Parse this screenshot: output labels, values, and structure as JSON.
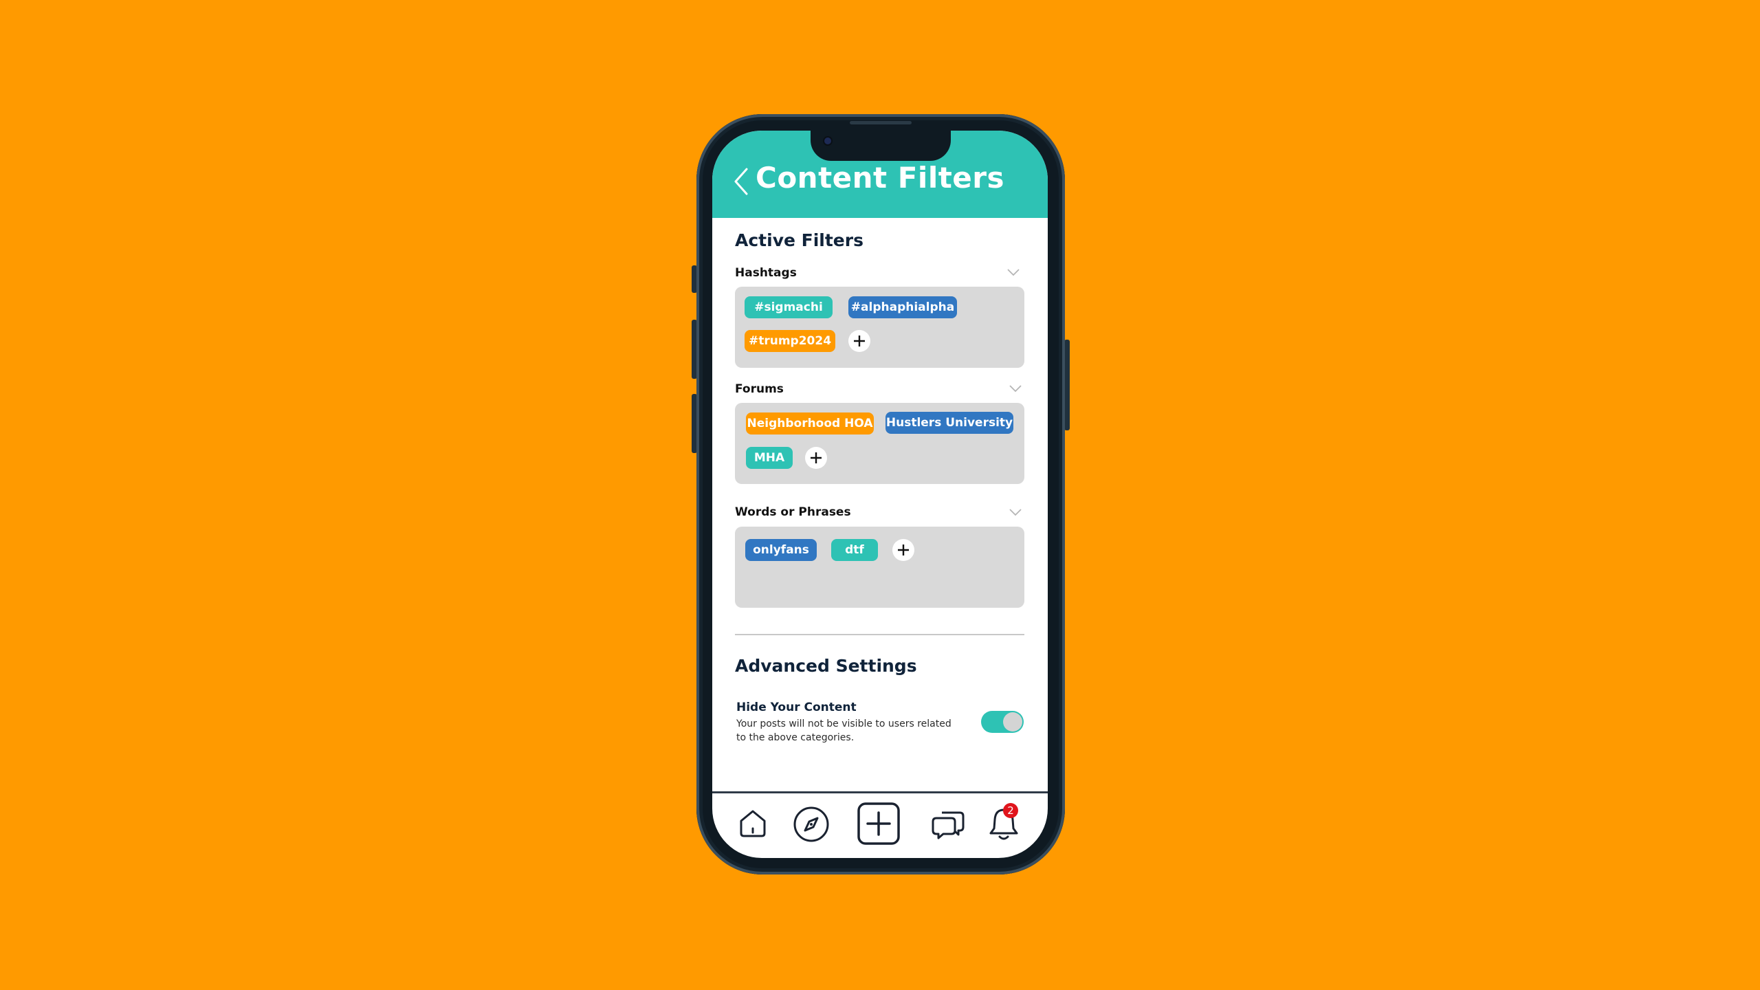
{
  "header": {
    "title": "Content Filters"
  },
  "active_filters": {
    "title": "Active Filters",
    "groups": [
      {
        "label": "Hashtags",
        "chips": [
          "#sigmachi",
          "#alphaphialpha",
          "#trump2024"
        ]
      },
      {
        "label": "Forums",
        "chips": [
          "Neighborhood HOA",
          "Hustlers University",
          "MHA"
        ]
      },
      {
        "label": "Words or Phrases",
        "chips": [
          "onlyfans",
          "dtf"
        ]
      }
    ]
  },
  "advanced": {
    "title": "Advanced Settings",
    "hide_content": {
      "label": "Hide Your Content",
      "description": "Your posts will not be visible to users related to the above categories.",
      "enabled": true
    }
  },
  "tabbar": {
    "notification_count": "2",
    "icons": [
      "home-icon",
      "compass-icon",
      "add-post-icon",
      "chat-icon",
      "bell-icon"
    ]
  },
  "colors": {
    "background": "#FF9A00",
    "header": "#2EC2B4",
    "chip_teal": "#2EC2B4",
    "chip_blue": "#3177C2",
    "chip_orange": "#FF9A00",
    "badge": "#E0141C"
  }
}
